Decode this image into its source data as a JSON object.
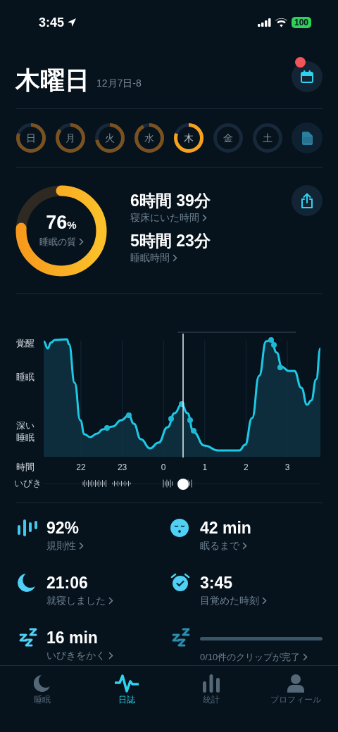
{
  "status_bar": {
    "time": "3:45",
    "battery": "100"
  },
  "header": {
    "day": "木曜日",
    "date": "12月7日-8",
    "calendar_badge": true
  },
  "week": [
    {
      "label": "日",
      "selected": false
    },
    {
      "label": "月",
      "selected": false
    },
    {
      "label": "火",
      "selected": false
    },
    {
      "label": "水",
      "selected": false
    },
    {
      "label": "木",
      "selected": true
    },
    {
      "label": "金",
      "selected": false
    },
    {
      "label": "土",
      "selected": false
    }
  ],
  "summary": {
    "quality": {
      "value": "76",
      "unit": "%",
      "label": "睡眠の質"
    },
    "metrics": [
      {
        "value": "6時間 39分",
        "label": "寝床にいた時間"
      },
      {
        "value": "5時間 23分",
        "label": "睡眠時間"
      }
    ]
  },
  "sleep_chart": {
    "stages": [
      "覚醒",
      "睡眠",
      "深い睡眠"
    ],
    "axis_label": "時間",
    "ticks": [
      "22",
      "23",
      "0",
      "1",
      "2",
      "3"
    ],
    "snore_label": "いびき"
  },
  "stats": [
    {
      "kind": "regularity",
      "value": "92%",
      "label": "規則性"
    },
    {
      "kind": "fall_asleep",
      "value": "42 min",
      "label": "眠るまで"
    },
    {
      "kind": "bedtime",
      "value": "21:06",
      "label": "就寝しました"
    },
    {
      "kind": "wake",
      "value": "3:45",
      "label": "目覚めた時刻"
    },
    {
      "kind": "snoring",
      "value": "16 min",
      "label": "いびきをかく"
    },
    {
      "kind": "clips",
      "level": 0,
      "label": "0/10件のクリップが完了"
    }
  ],
  "tabs": [
    {
      "kind": "moon",
      "label": "睡眠",
      "selected": false
    },
    {
      "kind": "wave",
      "label": "日誌",
      "selected": true
    },
    {
      "kind": "bars",
      "label": "統計",
      "selected": false
    },
    {
      "kind": "person",
      "label": "プロフィール",
      "selected": false
    }
  ]
}
